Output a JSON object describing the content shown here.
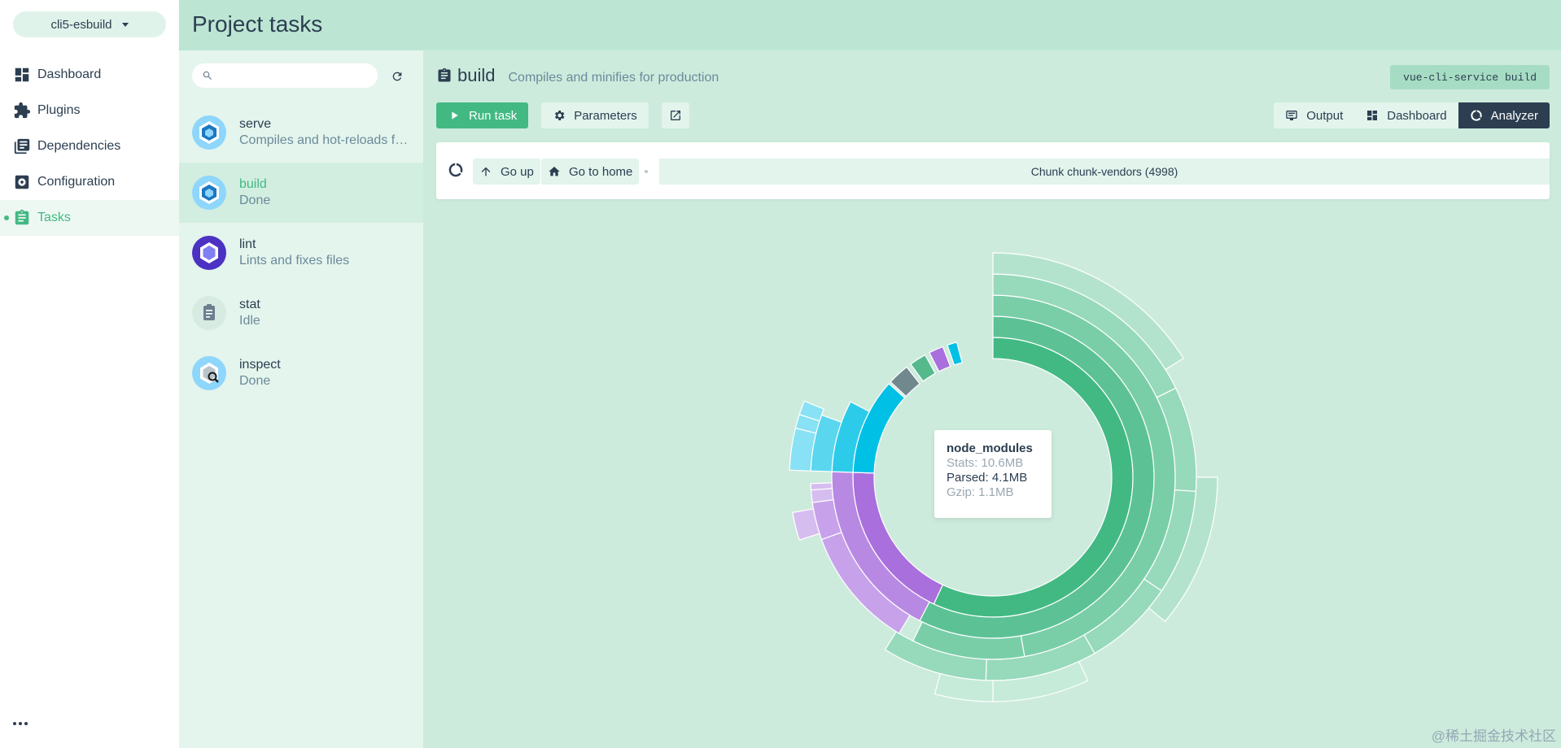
{
  "sidebar": {
    "project_name": "cli5-esbuild",
    "items": [
      {
        "label": "Dashboard",
        "icon": "dashboard-icon"
      },
      {
        "label": "Plugins",
        "icon": "puzzle-icon"
      },
      {
        "label": "Dependencies",
        "icon": "library-icon"
      },
      {
        "label": "Configuration",
        "icon": "settings-icon"
      },
      {
        "label": "Tasks",
        "icon": "clipboard-icon",
        "active": true
      }
    ]
  },
  "header": {
    "title": "Project tasks"
  },
  "tasks": {
    "search_placeholder": "",
    "items": [
      {
        "name": "serve",
        "desc": "Compiles and hot-reloads for development",
        "icon": "webpack-icon"
      },
      {
        "name": "build",
        "desc": "Done",
        "icon": "webpack-icon",
        "selected": true
      },
      {
        "name": "lint",
        "desc": "Lints and fixes files",
        "icon": "eslint-icon"
      },
      {
        "name": "stat",
        "desc": "Idle",
        "icon": "clipboard-icon"
      },
      {
        "name": "inspect",
        "desc": "Done",
        "icon": "inspect-icon"
      }
    ]
  },
  "task": {
    "title": "build",
    "subtitle": "Compiles and minifies for production",
    "command": "vue-cli-service build",
    "run_label": "Run task",
    "params_label": "Parameters"
  },
  "views": {
    "output": "Output",
    "dashboard": "Dashboard",
    "analyzer": "Analyzer",
    "active": "analyzer"
  },
  "analyzer": {
    "go_up": "Go up",
    "go_home": "Go to home",
    "chunk": "Chunk chunk-vendors (4998)"
  },
  "tooltip": {
    "title": "node_modules",
    "stats": "Stats: 10.6MB",
    "parsed": "Parsed: 4.1MB",
    "gzip": "Gzip: 1.1MB"
  },
  "colors": {
    "accent": "#42b983",
    "dark": "#2c3e50",
    "cyan": "#00c0e5",
    "purple": "#a96fdc",
    "slate": "#72888f"
  },
  "watermark": "@稀土掘金技术社区"
}
